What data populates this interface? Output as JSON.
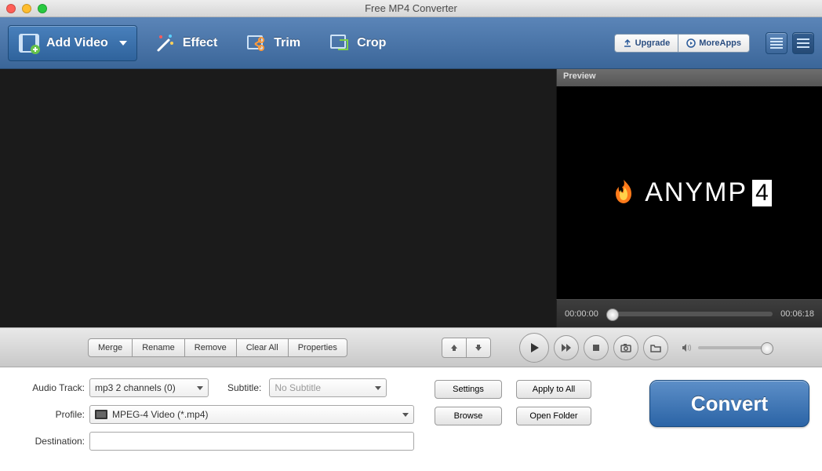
{
  "window": {
    "title": "Free MP4 Converter"
  },
  "toolbar": {
    "add_video": "Add Video",
    "effect": "Effect",
    "trim": "Trim",
    "crop": "Crop",
    "upgrade": "Upgrade",
    "more_apps": "MoreApps"
  },
  "preview": {
    "header": "Preview",
    "brand_text": "ANYMP",
    "brand_suffix": "4",
    "time_current": "00:00:00",
    "time_total": "00:06:18"
  },
  "list_actions": {
    "merge": "Merge",
    "rename": "Rename",
    "remove": "Remove",
    "clear_all": "Clear All",
    "properties": "Properties"
  },
  "form": {
    "audio_track_label": "Audio Track:",
    "audio_track_value": "mp3 2 channels (0)",
    "subtitle_label": "Subtitle:",
    "subtitle_value": "No Subtitle",
    "profile_label": "Profile:",
    "profile_value": "MPEG-4 Video (*.mp4)",
    "destination_label": "Destination:",
    "destination_value": "",
    "settings": "Settings",
    "browse": "Browse",
    "apply_all": "Apply to All",
    "open_folder": "Open Folder"
  },
  "convert_label": "Convert"
}
